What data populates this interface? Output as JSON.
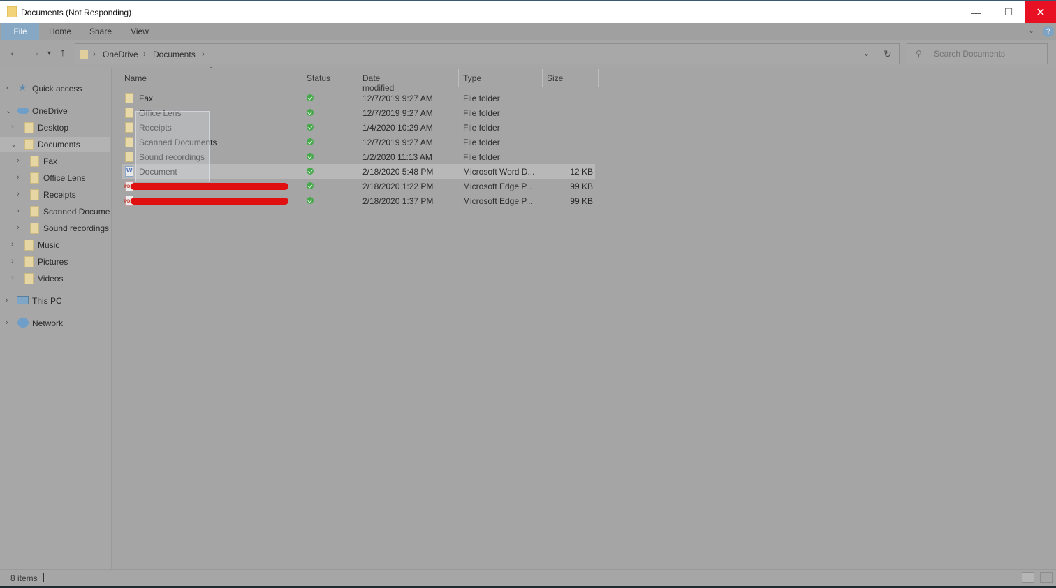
{
  "window": {
    "title": "Documents (Not Responding)",
    "minimize_glyph": "—",
    "maximize_glyph": "☐",
    "close_glyph": "✕"
  },
  "ribbon": {
    "tabs": [
      "File",
      "Home",
      "Share",
      "View"
    ],
    "help_glyph": "?"
  },
  "address": {
    "crumbs": [
      "OneDrive",
      "Documents"
    ],
    "search_placeholder": "Search Documents"
  },
  "navpane": {
    "quick_access": "Quick access",
    "onedrive": "OneDrive",
    "desktop": "Desktop",
    "documents": "Documents",
    "fax": "Fax",
    "office_lens": "Office Lens",
    "receipts": "Receipts",
    "scanned": "Scanned Documents",
    "sound": "Sound recordings",
    "music": "Music",
    "pictures": "Pictures",
    "videos": "Videos",
    "this_pc": "This PC",
    "network": "Network"
  },
  "columns": {
    "name": "Name",
    "status": "Status",
    "date": "Date modified",
    "type": "Type",
    "size": "Size"
  },
  "files": [
    {
      "name": "Fax",
      "date": "12/7/2019 9:27 AM",
      "type": "File folder",
      "size": ""
    },
    {
      "name": "Office Lens",
      "date": "12/7/2019 9:27 AM",
      "type": "File folder",
      "size": ""
    },
    {
      "name": "Receipts",
      "date": "1/4/2020 10:29 AM",
      "type": "File folder",
      "size": ""
    },
    {
      "name": "Scanned Documents",
      "date": "12/7/2019 9:27 AM",
      "type": "File folder",
      "size": ""
    },
    {
      "name": "Sound recordings",
      "date": "1/2/2020 11:13 AM",
      "type": "File folder",
      "size": ""
    },
    {
      "name": "Document",
      "date": "2/18/2020 5:48 PM",
      "type": "Microsoft Word D...",
      "size": "12 KB"
    },
    {
      "name": "",
      "date": "2/18/2020 1:22 PM",
      "type": "Microsoft Edge P...",
      "size": "99 KB"
    },
    {
      "name": "",
      "date": "2/18/2020 1:37 PM",
      "type": "Microsoft Edge P...",
      "size": "99 KB"
    }
  ],
  "statusbar": {
    "count": "8 items"
  },
  "colors": {
    "close_red": "#e81123",
    "sync_green": "#46a84b",
    "redaction_red": "#e01010",
    "file_tab": "#86a8c4"
  }
}
